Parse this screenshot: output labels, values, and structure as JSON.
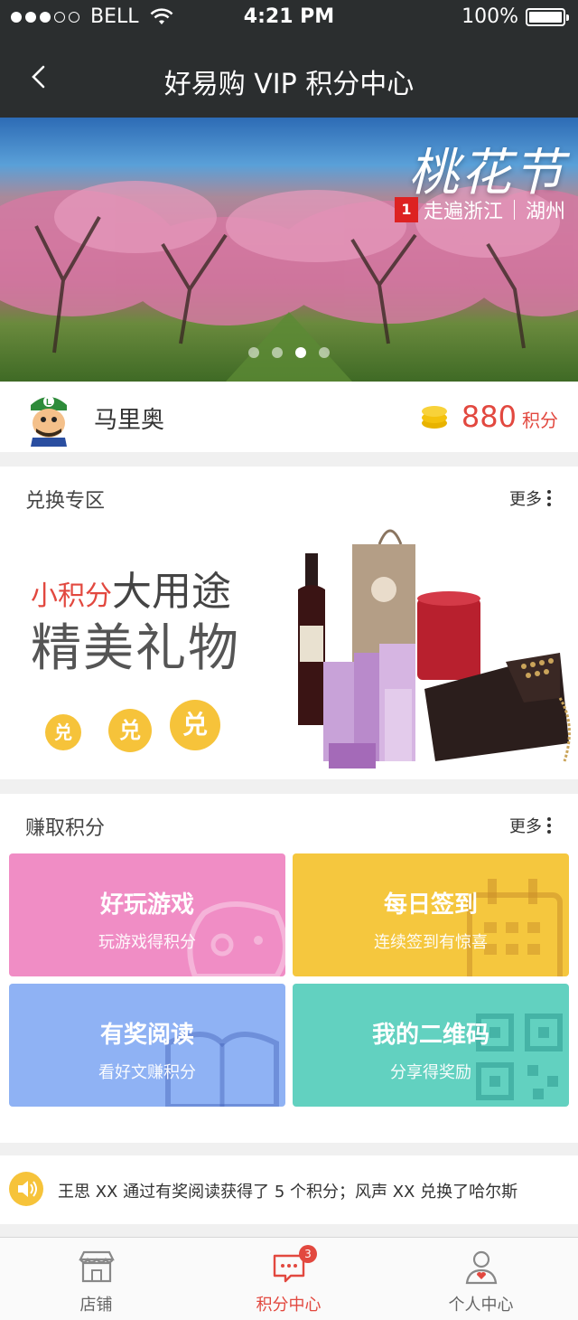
{
  "status_bar": {
    "carrier": "BELL",
    "time": "4:21 PM",
    "battery": "100%"
  },
  "nav": {
    "title": "好易购 VIP 积分中心",
    "back_icon": "chevron-left-icon"
  },
  "banner": {
    "title": "桃花节",
    "badge": "1",
    "subtitle_left": "走遍浙江",
    "subtitle_right": "湖州",
    "slide_count": 4,
    "active_slide": 3
  },
  "user": {
    "name": "马里奥",
    "points": "880",
    "points_unit": "积分"
  },
  "exchange": {
    "header": "兑换专区",
    "more": "更多",
    "promo_red": "小积分",
    "promo_rest": "大用途",
    "promo_line2": "精美礼物",
    "dui": [
      "兑",
      "兑",
      "兑"
    ]
  },
  "earn": {
    "header": "赚取积分",
    "more": "更多",
    "cards": [
      {
        "title": "好玩游戏",
        "subtitle": "玩游戏得积分",
        "color": "#f08dc5"
      },
      {
        "title": "每日签到",
        "subtitle": "连续签到有惊喜",
        "color": "#f5c73e"
      },
      {
        "title": "有奖阅读",
        "subtitle": "看好文赚积分",
        "color": "#8fb2f4"
      },
      {
        "title": "我的二维码",
        "subtitle": "分享得奖励",
        "color": "#62d1c0"
      }
    ]
  },
  "ticker": {
    "text": "王思 XX 通过有奖阅读获得了 5 个积分；风声 XX 兑换了哈尔斯"
  },
  "tabbar": {
    "items": [
      {
        "label": "店铺",
        "icon": "store-icon"
      },
      {
        "label": "积分中心",
        "icon": "chat-points-icon",
        "badge": "3"
      },
      {
        "label": "个人中心",
        "icon": "person-icon"
      }
    ],
    "accent": "#e2483f"
  }
}
